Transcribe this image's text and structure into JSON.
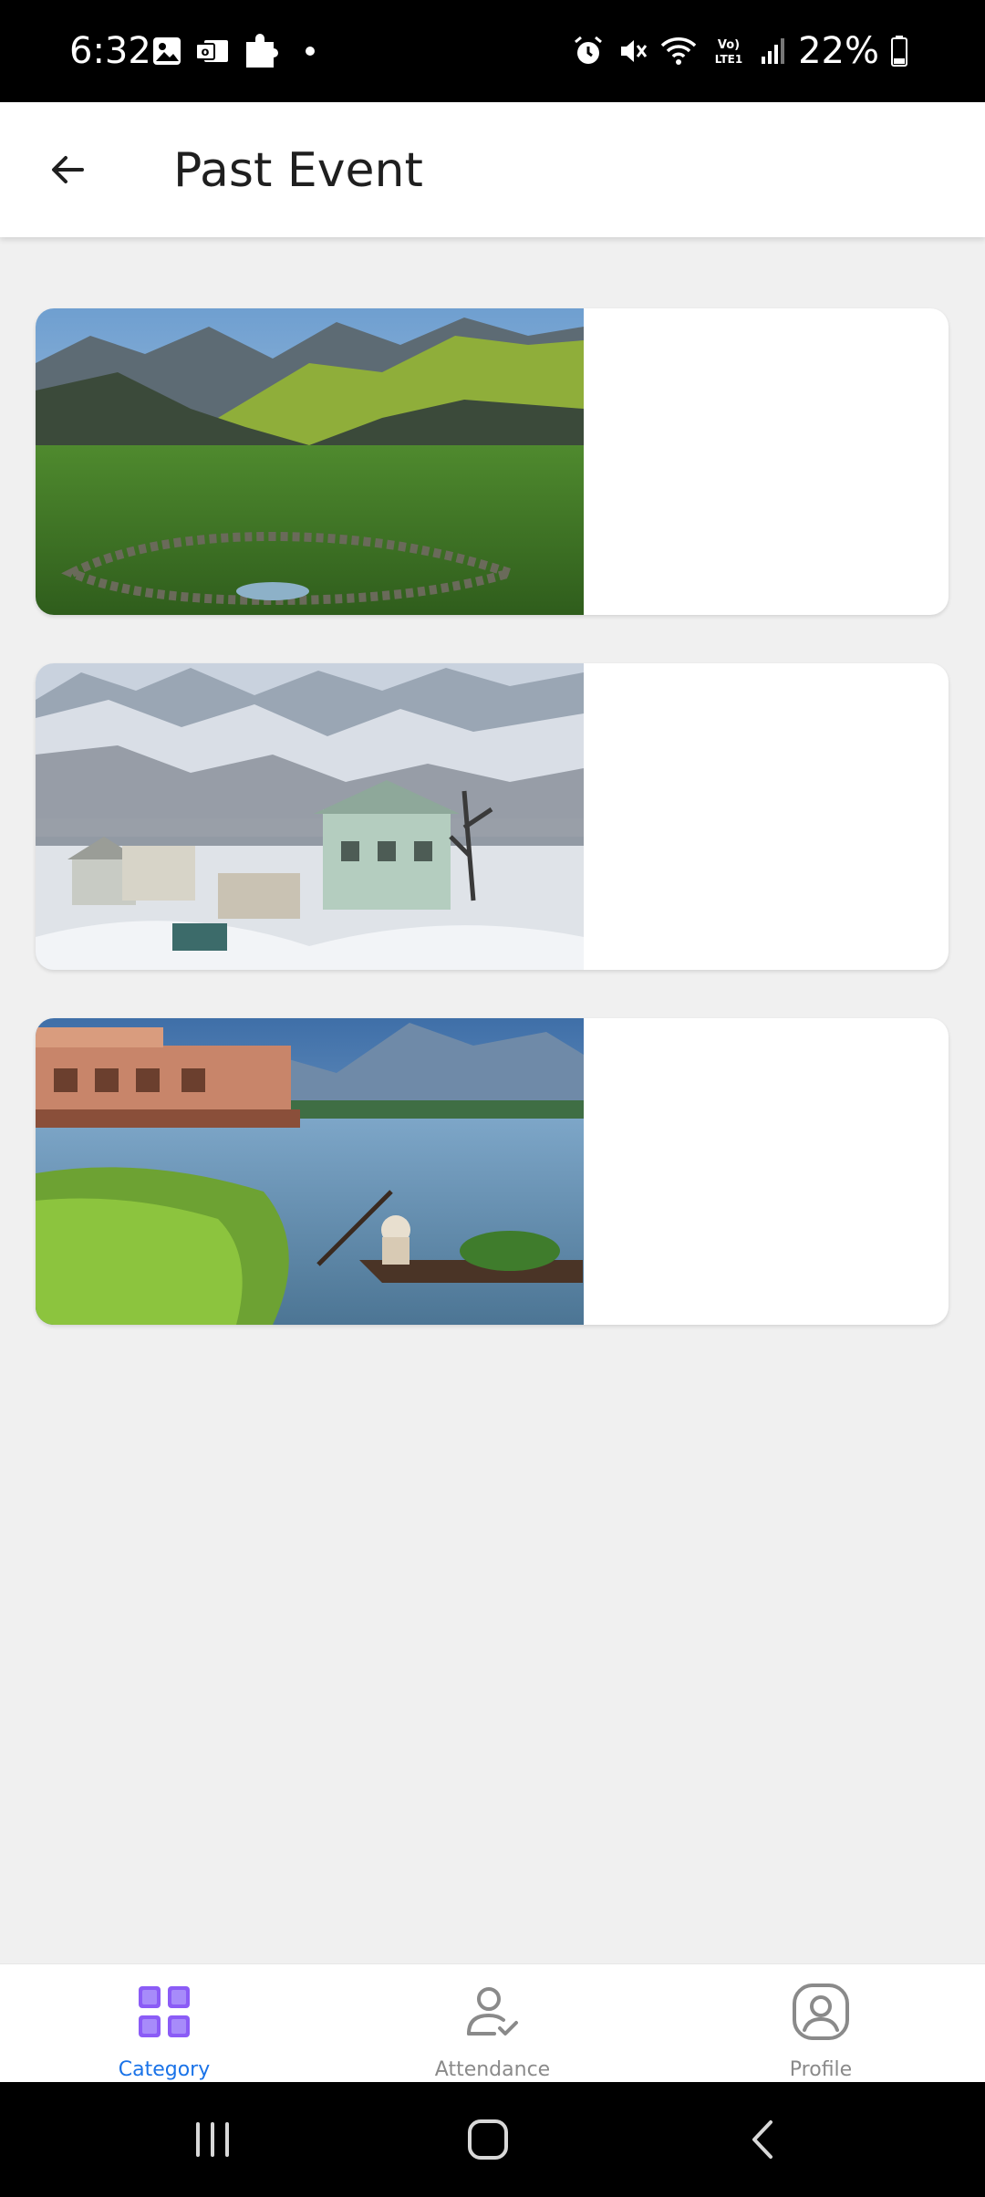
{
  "status_bar": {
    "time": "6:32",
    "battery_text": "22%",
    "left_icons": [
      "image-icon",
      "outlook-icon",
      "puzzle-icon",
      "dot-icon"
    ],
    "right_icons": [
      "alarm-icon",
      "mute-icon",
      "wifi-icon",
      "volte-icon",
      "signal-icon",
      "battery-icon"
    ],
    "volte_label": "Vo)\nLTE1"
  },
  "app_bar": {
    "back_icon": "arrow-left-icon",
    "title": "Past Event"
  },
  "events": [
    {
      "image": "mountain-meadow-image"
    },
    {
      "image": "snowy-village-image"
    },
    {
      "image": "lake-houseboat-image"
    }
  ],
  "bottom_nav": {
    "items": [
      {
        "label": "Category",
        "icon": "grid-icon",
        "active": true
      },
      {
        "label": "Attendance",
        "icon": "user-check-icon",
        "active": false
      },
      {
        "label": "Profile",
        "icon": "profile-icon",
        "active": false
      }
    ],
    "active_color": "#1a73e8",
    "inactive_color": "#8a8a8a",
    "icon_active_color": "#8b5cf6"
  },
  "system_nav": {
    "buttons": [
      "recents-icon",
      "home-icon",
      "back-icon"
    ]
  }
}
